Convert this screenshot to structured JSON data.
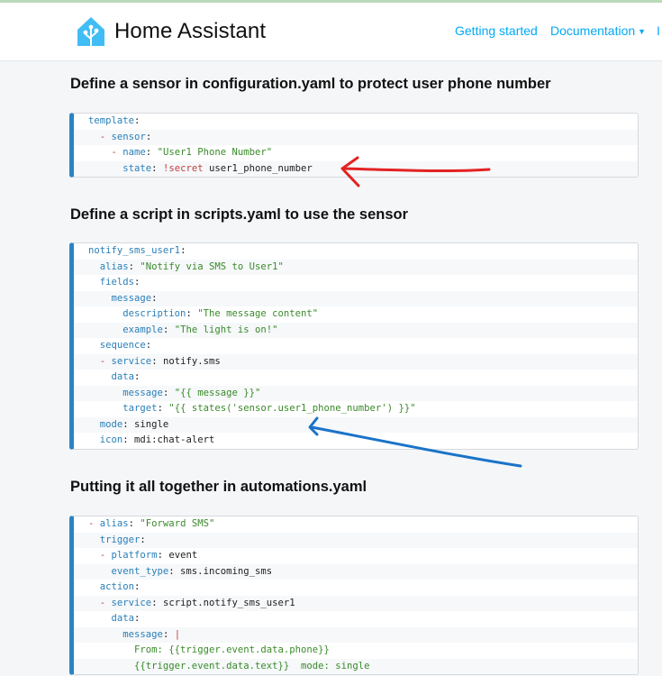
{
  "header": {
    "brand": "Home Assistant",
    "nav": [
      {
        "label": "Getting started"
      },
      {
        "label": "Documentation",
        "caret": "▼"
      },
      {
        "label": "I"
      }
    ]
  },
  "sections": [
    {
      "title": "Define a sensor in configuration.yaml to protect user phone number",
      "lines": [
        [
          {
            "t": "k",
            "v": "template"
          },
          {
            "t": "p",
            "v": ":"
          }
        ],
        [
          {
            "t": "p",
            "v": "  "
          },
          {
            "t": "sym",
            "v": "- "
          },
          {
            "t": "k",
            "v": "sensor"
          },
          {
            "t": "p",
            "v": ":"
          }
        ],
        [
          {
            "t": "p",
            "v": "    "
          },
          {
            "t": "sym",
            "v": "- "
          },
          {
            "t": "k",
            "v": "name"
          },
          {
            "t": "p",
            "v": ": "
          },
          {
            "t": "s",
            "v": "\"User1 Phone Number\""
          }
        ],
        [
          {
            "t": "p",
            "v": "      "
          },
          {
            "t": "k",
            "v": "state"
          },
          {
            "t": "p",
            "v": ": "
          },
          {
            "t": "sym",
            "v": "!secret"
          },
          {
            "t": "p",
            "v": " user1_phone_number"
          }
        ]
      ]
    },
    {
      "title": "Define a script in scripts.yaml to use the sensor",
      "lines": [
        [
          {
            "t": "k",
            "v": "notify_sms_user1"
          },
          {
            "t": "p",
            "v": ":"
          }
        ],
        [
          {
            "t": "p",
            "v": "  "
          },
          {
            "t": "k",
            "v": "alias"
          },
          {
            "t": "p",
            "v": ": "
          },
          {
            "t": "s",
            "v": "\"Notify via SMS to User1\""
          }
        ],
        [
          {
            "t": "p",
            "v": "  "
          },
          {
            "t": "k",
            "v": "fields"
          },
          {
            "t": "p",
            "v": ":"
          }
        ],
        [
          {
            "t": "p",
            "v": "    "
          },
          {
            "t": "k",
            "v": "message"
          },
          {
            "t": "p",
            "v": ":"
          }
        ],
        [
          {
            "t": "p",
            "v": "      "
          },
          {
            "t": "k",
            "v": "description"
          },
          {
            "t": "p",
            "v": ": "
          },
          {
            "t": "s",
            "v": "\"The message content\""
          }
        ],
        [
          {
            "t": "p",
            "v": "      "
          },
          {
            "t": "k",
            "v": "example"
          },
          {
            "t": "p",
            "v": ": "
          },
          {
            "t": "s",
            "v": "\"The light is on!\""
          }
        ],
        [
          {
            "t": "p",
            "v": "  "
          },
          {
            "t": "k",
            "v": "sequence"
          },
          {
            "t": "p",
            "v": ":"
          }
        ],
        [
          {
            "t": "p",
            "v": "  "
          },
          {
            "t": "sym",
            "v": "- "
          },
          {
            "t": "k",
            "v": "service"
          },
          {
            "t": "p",
            "v": ": notify.sms"
          }
        ],
        [
          {
            "t": "p",
            "v": "    "
          },
          {
            "t": "k",
            "v": "data"
          },
          {
            "t": "p",
            "v": ":"
          }
        ],
        [
          {
            "t": "p",
            "v": "      "
          },
          {
            "t": "k",
            "v": "message"
          },
          {
            "t": "p",
            "v": ": "
          },
          {
            "t": "s",
            "v": "\"{{ message }}\""
          }
        ],
        [
          {
            "t": "p",
            "v": "      "
          },
          {
            "t": "k",
            "v": "target"
          },
          {
            "t": "p",
            "v": ": "
          },
          {
            "t": "s",
            "v": "\"{{ states('sensor.user1_phone_number') }}\""
          }
        ],
        [
          {
            "t": "p",
            "v": "  "
          },
          {
            "t": "k",
            "v": "mode"
          },
          {
            "t": "p",
            "v": ": single"
          }
        ],
        [
          {
            "t": "p",
            "v": "  "
          },
          {
            "t": "k",
            "v": "icon"
          },
          {
            "t": "p",
            "v": ": mdi:chat-alert"
          }
        ]
      ]
    },
    {
      "title": "Putting it all together in automations.yaml",
      "lines": [
        [
          {
            "t": "sym",
            "v": "- "
          },
          {
            "t": "k",
            "v": "alias"
          },
          {
            "t": "p",
            "v": ": "
          },
          {
            "t": "s",
            "v": "\"Forward SMS\""
          }
        ],
        [
          {
            "t": "p",
            "v": "  "
          },
          {
            "t": "k",
            "v": "trigger"
          },
          {
            "t": "p",
            "v": ":"
          }
        ],
        [
          {
            "t": "p",
            "v": "  "
          },
          {
            "t": "sym",
            "v": "- "
          },
          {
            "t": "k",
            "v": "platform"
          },
          {
            "t": "p",
            "v": ": event"
          }
        ],
        [
          {
            "t": "p",
            "v": "    "
          },
          {
            "t": "k",
            "v": "event_type"
          },
          {
            "t": "p",
            "v": ": sms.incoming_sms"
          }
        ],
        [
          {
            "t": "p",
            "v": "  "
          },
          {
            "t": "k",
            "v": "action"
          },
          {
            "t": "p",
            "v": ":"
          }
        ],
        [
          {
            "t": "p",
            "v": "  "
          },
          {
            "t": "sym",
            "v": "- "
          },
          {
            "t": "k",
            "v": "service"
          },
          {
            "t": "p",
            "v": ": script.notify_sms_user1"
          }
        ],
        [
          {
            "t": "p",
            "v": "    "
          },
          {
            "t": "k",
            "v": "data"
          },
          {
            "t": "p",
            "v": ":"
          }
        ],
        [
          {
            "t": "p",
            "v": "      "
          },
          {
            "t": "k",
            "v": "message"
          },
          {
            "t": "p",
            "v": ": "
          },
          {
            "t": "sym",
            "v": "|"
          }
        ],
        [
          {
            "t": "p",
            "v": "        "
          },
          {
            "t": "s",
            "v": "From: {{trigger.event.data.phone}}"
          }
        ],
        [
          {
            "t": "p",
            "v": "        "
          },
          {
            "t": "s",
            "v": "{{trigger.event.data.text}}  mode: single"
          }
        ]
      ]
    }
  ],
  "colors": {
    "accent": "#03a9f4",
    "code_border": "#2a84c6",
    "key": "#2a7fb8",
    "string": "#3a8a2a",
    "symbol": "#c04040",
    "arrow_red": "#e32222",
    "arrow_blue": "#1a73c8"
  }
}
